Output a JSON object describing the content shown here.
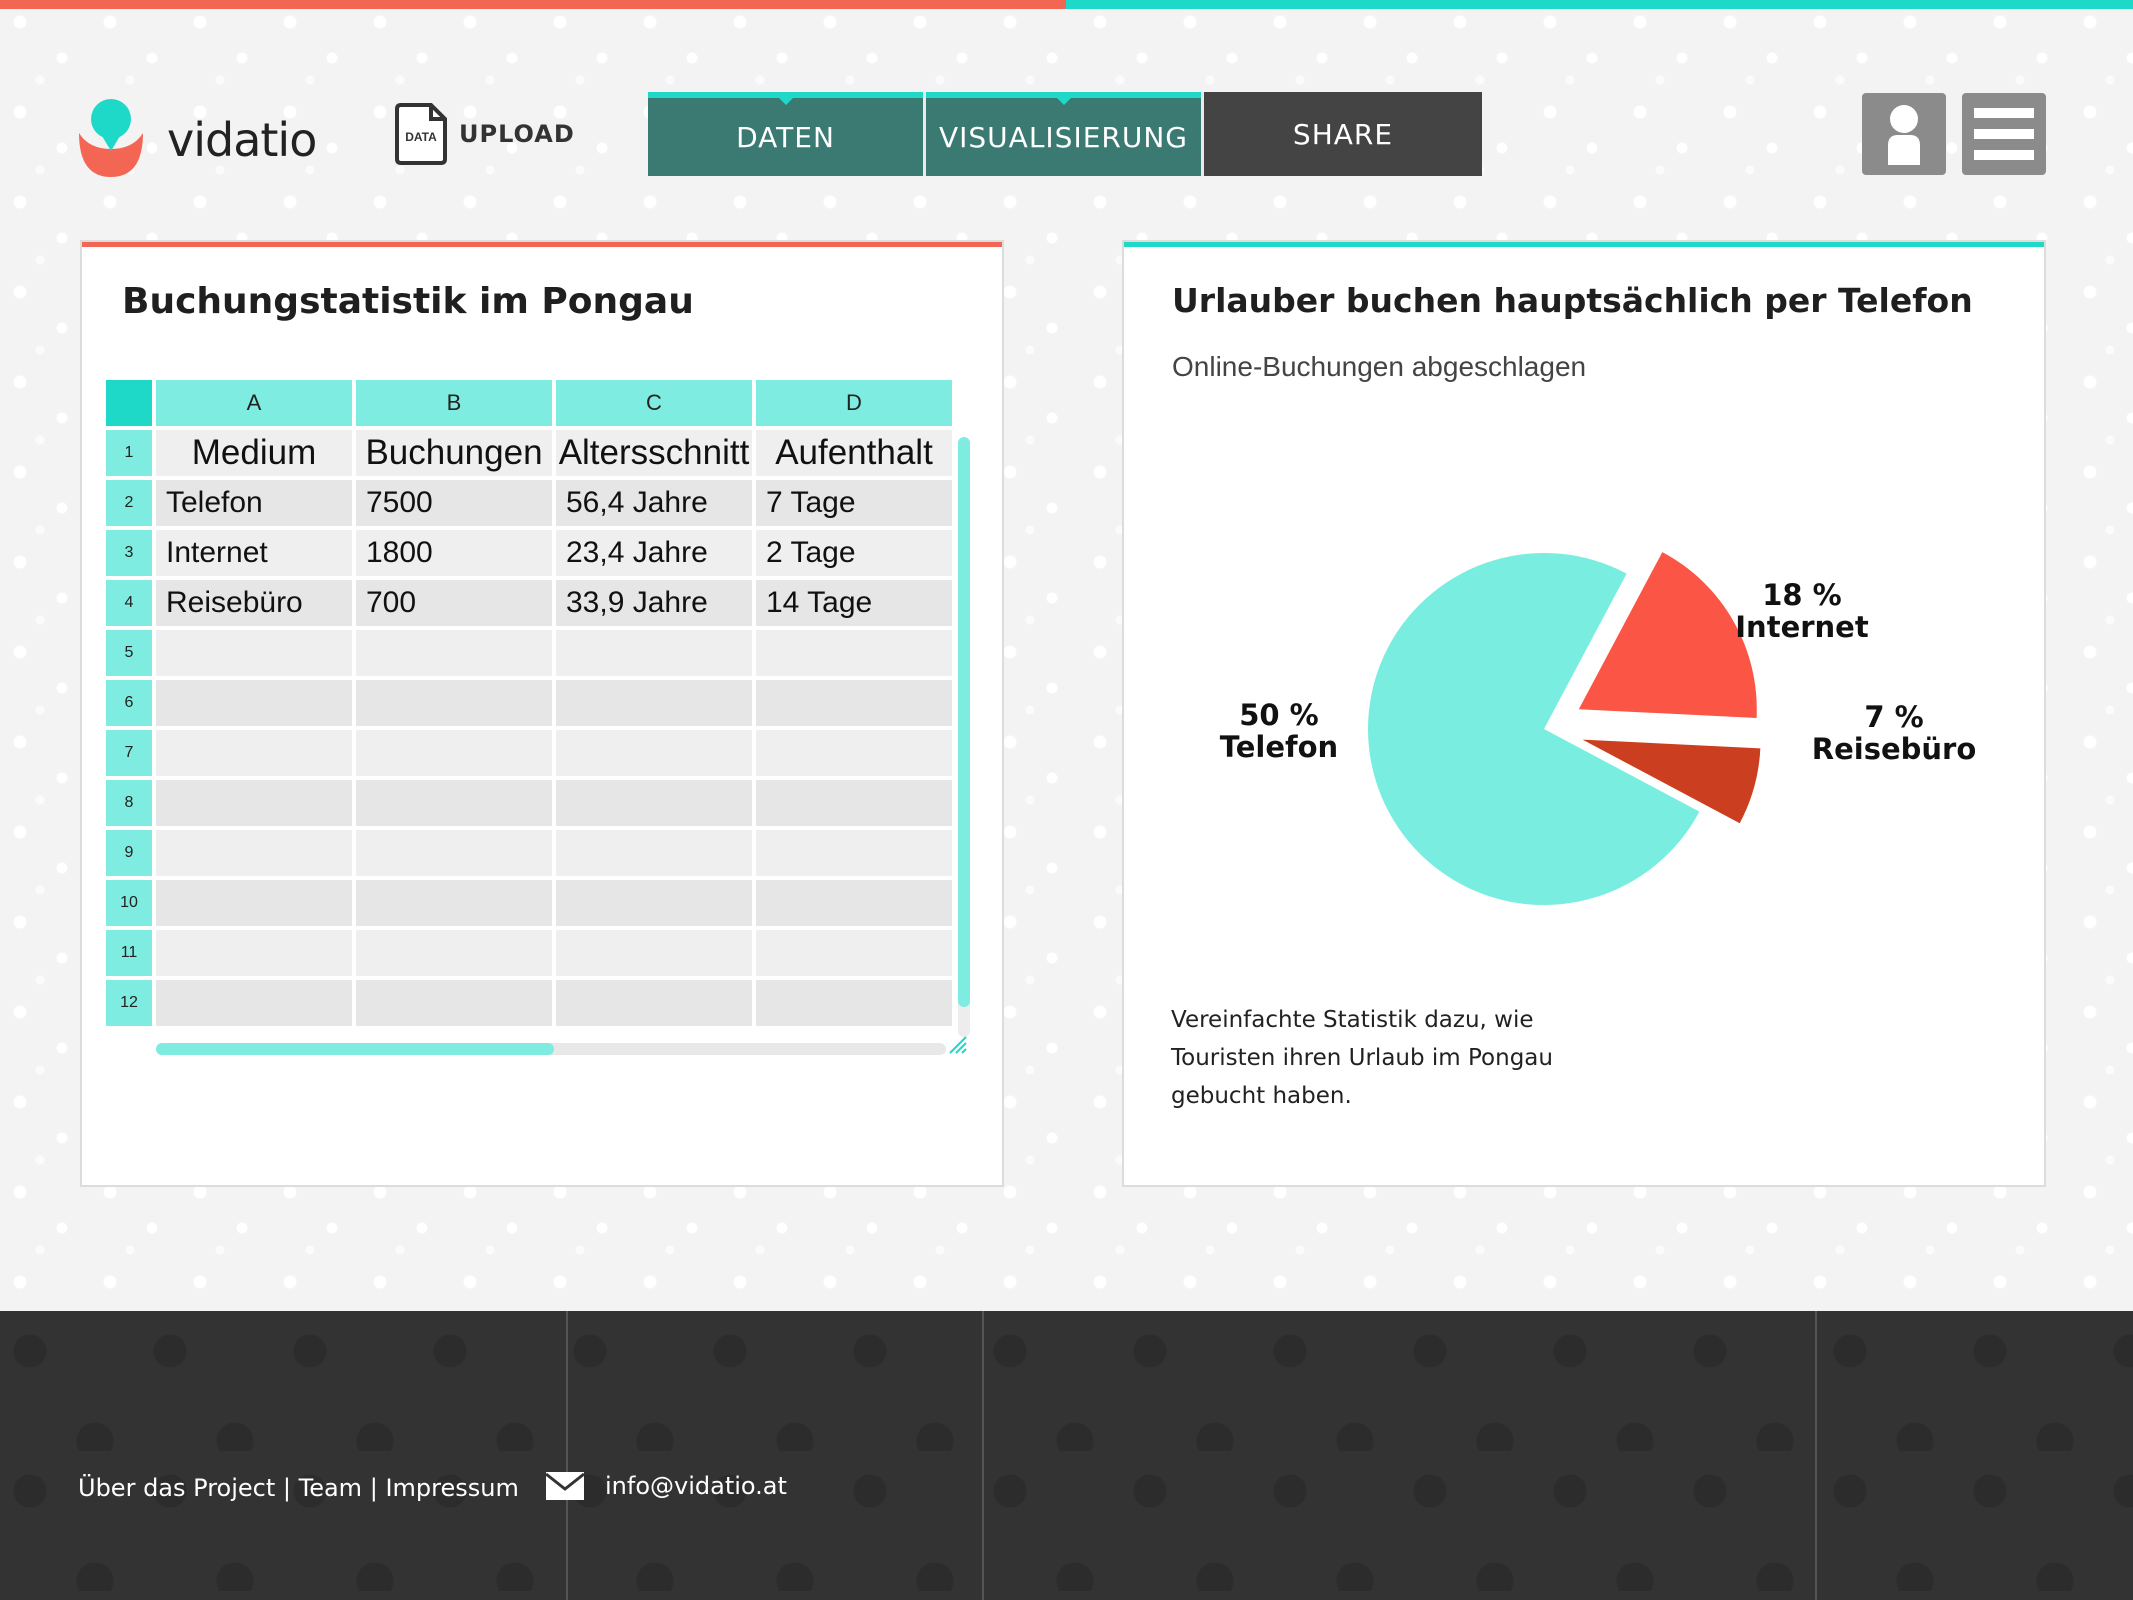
{
  "app": {
    "name": "vidatio"
  },
  "colors": {
    "accent_red": "#f36654",
    "accent_teal": "#1ed9c8",
    "nav_teal": "#3b7a72",
    "nav_dark": "#444444",
    "pie_teal": "#78ede0",
    "pie_red": "#fb5546",
    "pie_darkred": "#cb3f20"
  },
  "header": {
    "upload_icon_label": "DATA",
    "upload_label": "UPLOAD",
    "nav": [
      {
        "label": "DATEN"
      },
      {
        "label": "VISUALISIERUNG"
      },
      {
        "label": "SHARE"
      }
    ],
    "user_icon": "user-icon",
    "menu_icon": "hamburger-menu-icon"
  },
  "left_panel": {
    "title": "Buchungstatistik im Pongau",
    "columns": [
      "A",
      "B",
      "C",
      "D"
    ],
    "row_numbers": [
      "1",
      "2",
      "3",
      "4",
      "5",
      "6",
      "7",
      "8",
      "9",
      "10",
      "11",
      "12"
    ],
    "rows": [
      [
        "Medium",
        "Buchungen",
        "Altersschnitt",
        "Aufenthalt"
      ],
      [
        "Telefon",
        "7500",
        "56,4 Jahre",
        " 7 Tage"
      ],
      [
        "Internet",
        "1800",
        "23,4 Jahre",
        "2 Tage"
      ],
      [
        "Reisebüro",
        "700",
        "33,9 Jahre",
        "14 Tage"
      ],
      [
        "",
        "",
        "",
        ""
      ],
      [
        "",
        "",
        "",
        ""
      ],
      [
        "",
        "",
        "",
        ""
      ],
      [
        "",
        "",
        "",
        ""
      ],
      [
        "",
        "",
        "",
        ""
      ],
      [
        "",
        "",
        "",
        ""
      ],
      [
        "",
        "",
        "",
        ""
      ],
      [
        "",
        "",
        "",
        ""
      ]
    ]
  },
  "right_panel": {
    "title": "Urlauber buchen hauptsächlich per Telefon",
    "subtitle": "Online-Buchungen abgeschlagen",
    "description": "Vereinfachte Statistik dazu, wie Touristen ihren Urlaub im Pongau gebucht haben."
  },
  "chart_data": {
    "type": "pie",
    "title": "Urlauber buchen hauptsächlich per Telefon",
    "slices": [
      {
        "label": "Telefon",
        "percent_label": "50 %",
        "value": 7500,
        "color": "#78ede0",
        "exploded": false
      },
      {
        "label": "Internet",
        "percent_label": "18 %",
        "value": 1800,
        "color": "#fb5546",
        "exploded": true
      },
      {
        "label": "Reisebüro",
        "percent_label": "7 %",
        "value": 700,
        "color": "#cb3f20",
        "exploded": true
      }
    ]
  },
  "footer": {
    "link_about": "Über das Project",
    "sep": "|",
    "link_team": "Team",
    "link_impressum": "Impressum",
    "email": "info@vidatio.at"
  }
}
